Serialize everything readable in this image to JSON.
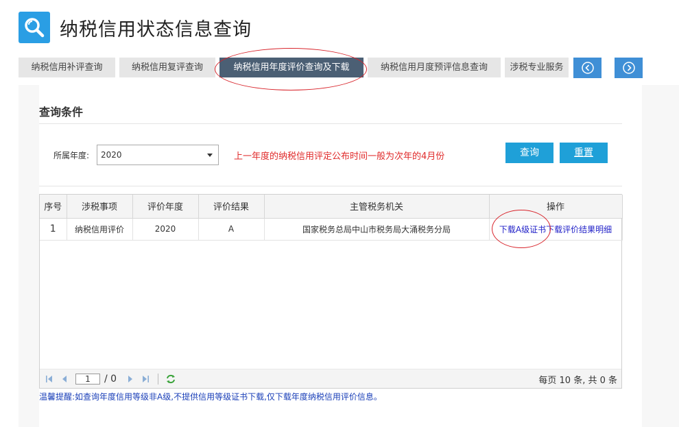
{
  "header": {
    "title": "纳税信用状态信息查询",
    "logo_icon": "search-icon"
  },
  "tabs": [
    {
      "label": "纳税信用补评查询"
    },
    {
      "label": "纳税信用复评查询"
    },
    {
      "label": "纳税信用年度评价查询及下载",
      "active": true
    },
    {
      "label": "纳税信用月度预评信息查询"
    },
    {
      "label": "涉税专业服务"
    }
  ],
  "nav": {
    "prev_icon": "chevron-left-icon",
    "next_icon": "chevron-right-icon"
  },
  "query": {
    "section_title": "查询条件",
    "year_label": "所属年度:",
    "year_value": "2020",
    "notice": "上一年度的纳税信用评定公布时间一般为次年的4月份",
    "search_button": "查询",
    "reset_button": "重置"
  },
  "table": {
    "columns": [
      "序号",
      "涉税事项",
      "评价年度",
      "评价结果",
      "主管税务机关",
      "操作"
    ],
    "rows": [
      {
        "seq": "1",
        "item": "纳税信用评价",
        "year": "2020",
        "result": "A",
        "authority": "国家税务总局中山市税务局大涌税务分局",
        "action_download_cert": "下载A级证书",
        "action_download_detail": "下载评价结果明细"
      }
    ]
  },
  "pager": {
    "page": "1",
    "total_pages": "/ 0",
    "summary": "每页 10 条, 共 0 条"
  },
  "tip": "温馨提醒:如查询年度信用等级非A级,不提供信用等级证书下载,仅下载年度纳税信用评价信息。",
  "colors": {
    "accent": "#1fa0d8",
    "active_tab": "#4b5f74",
    "notice": "#e02a2a",
    "link": "#2222c8",
    "highlight": "#d8232a"
  }
}
